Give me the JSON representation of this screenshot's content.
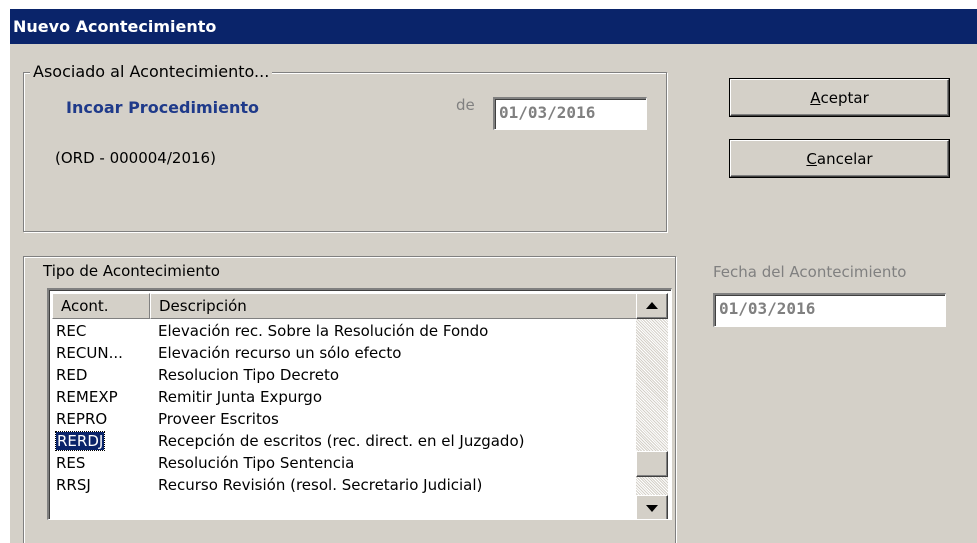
{
  "window": {
    "title": "Nuevo Acontecimiento"
  },
  "associated": {
    "legend": "Asociado al Acontecimiento...",
    "event_name": "Incoar Procedimiento",
    "date_prefix": "de",
    "date_value": "01/03/2016",
    "reference": "(ORD - 000004/2016)"
  },
  "buttons": {
    "accept_mnemonic": "A",
    "accept_rest": "ceptar",
    "cancel_mnemonic": "C",
    "cancel_rest": "ancelar"
  },
  "event_type": {
    "legend": "Tipo de Acontecimiento",
    "columns": [
      "Acont.",
      "Descripción"
    ],
    "rows": [
      {
        "code": "REC",
        "description": "Elevación rec. Sobre la Resolución de Fondo"
      },
      {
        "code": "RECUN...",
        "description": "Elevación recurso un sólo efecto"
      },
      {
        "code": "RED",
        "description": "Resolucion Tipo Decreto"
      },
      {
        "code": "REMEXP",
        "description": "Remitir Junta Expurgo"
      },
      {
        "code": "REPRO",
        "description": "Proveer Escritos"
      },
      {
        "code": "RERDJ",
        "description": "Recepción de escritos (rec. direct. en el Juzgado)"
      },
      {
        "code": "RES",
        "description": "Resolución Tipo Sentencia"
      },
      {
        "code": "RRSJ",
        "description": "Recurso Revisión (resol. Secretario Judicial)"
      }
    ],
    "selected_index": 5,
    "scroll_position": 0.88
  },
  "event_date": {
    "label": "Fecha del Acontecimiento",
    "value": "01/03/2016"
  },
  "colors": {
    "title_bar": "#0a246a",
    "dialog_bg": "#d4d0c8",
    "link_text": "#1f3a8a",
    "disabled_text": "#808080",
    "selection": "#0a246a"
  },
  "icons": [
    "scroll-up-arrow-icon",
    "scroll-down-arrow-icon"
  ]
}
